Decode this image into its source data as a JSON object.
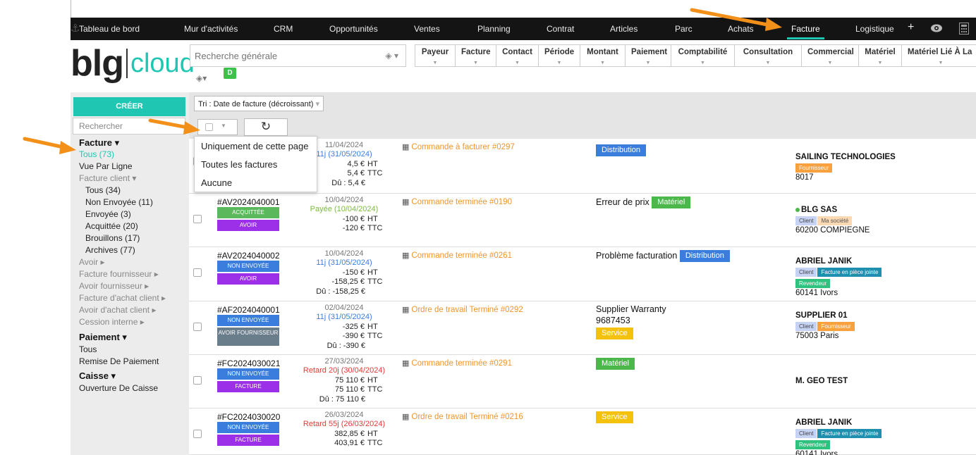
{
  "topnav": {
    "items": [
      "Tableau de bord",
      "Mur d'activités",
      "CRM",
      "Opportunités",
      "Ventes",
      "Planning",
      "Contrat",
      "Articles",
      "Parc",
      "Achats",
      "Facture",
      "Logistique",
      "+"
    ],
    "active": "Facture"
  },
  "logo": {
    "left": "blg",
    "right": "cloud"
  },
  "search": {
    "placeholder": "Recherche générale",
    "badge": "D"
  },
  "filters": [
    "Payeur",
    "Facture",
    "Contact",
    "Période",
    "Montant",
    "Paiement",
    "Comptabilité",
    "Consultation",
    "Commercial",
    "Matériel",
    "Matériel Lié À La"
  ],
  "sidebar": {
    "create": "CRÉER",
    "search_placeholder": "Rechercher",
    "facture_header": "Facture ▾",
    "items": [
      {
        "label": "Tous (73)",
        "style": "active"
      },
      {
        "label": "Vue Par Ligne",
        "style": ""
      },
      {
        "label": "Facture client ▾",
        "style": "grey"
      },
      {
        "label": "Tous (34)",
        "style": "ind"
      },
      {
        "label": "Non Envoyée (11)",
        "style": "ind"
      },
      {
        "label": "Envoyée (3)",
        "style": "ind"
      },
      {
        "label": "Acquittée (20)",
        "style": "ind"
      },
      {
        "label": "Brouillons (17)",
        "style": "ind"
      },
      {
        "label": "Archives (77)",
        "style": "ind"
      },
      {
        "label": "Avoir ▸",
        "style": "grey"
      },
      {
        "label": "Facture fournisseur ▸",
        "style": "grey"
      },
      {
        "label": "Avoir fournisseur ▸",
        "style": "grey"
      },
      {
        "label": "Facture d'achat client ▸",
        "style": "grey"
      },
      {
        "label": "Avoir d'achat client ▸",
        "style": "grey"
      },
      {
        "label": "Cession interne ▸",
        "style": "grey"
      }
    ],
    "paiement_header": "Paiement ▾",
    "paiement_items": [
      "Tous",
      "Remise De Paiement"
    ],
    "caisse_header": "Caisse ▾",
    "caisse_items": [
      "Ouverture De Caisse"
    ]
  },
  "sort": {
    "label": "Tri : Date de facture (décroissant)"
  },
  "dropdown": {
    "options": [
      "Uniquement de cette page",
      "Toutes les factures",
      "Aucune"
    ]
  },
  "rows": [
    {
      "number": "",
      "badges": [],
      "date": "11/04/2024",
      "due": "11j (31/05/2024)",
      "due_color": "blue",
      "ht": "4,5 €",
      "ttc": "5,4 €",
      "du": "Dû : 5,4 €",
      "cmd": "Commande à facturer #0297",
      "obj_text": "",
      "obj_tag": "Distribution",
      "obj_tag_color": "blue",
      "obj_sub": "",
      "client": "SAILING TECHNOLOGIES",
      "client_dot": false,
      "client_tags": [
        {
          "t": "Fournisseur",
          "c": "orange"
        }
      ],
      "client_tags2": [],
      "client_addr": "8017"
    },
    {
      "number": "#AV2024040001",
      "badges": [
        {
          "t": "ACQUITTÉE",
          "c": "green"
        },
        {
          "t": "AVOIR",
          "c": "purple"
        }
      ],
      "date": "10/04/2024",
      "due": "Payée (10/04/2024)",
      "due_color": "green",
      "ht": "-100 €",
      "ttc": "-120 €",
      "du": "",
      "cmd": "Commande terminée #0190",
      "obj_text": "Erreur de prix",
      "obj_tag": "Matériel",
      "obj_tag_color": "green",
      "obj_sub": "",
      "client": "BLG SAS",
      "client_dot": true,
      "client_tags": [
        {
          "t": "Client",
          "c": "client"
        },
        {
          "t": "Ma société",
          "c": "soc"
        }
      ],
      "client_tags2": [],
      "client_addr": "60200 COMPIEGNE"
    },
    {
      "number": "#AV2024040002",
      "badges": [
        {
          "t": "NON ENVOYÉE",
          "c": "blue"
        },
        {
          "t": "AVOIR",
          "c": "purple"
        }
      ],
      "date": "10/04/2024",
      "due": "11j (31/05/2024)",
      "due_color": "blue",
      "ht": "-150 €",
      "ttc": "-158,25 €",
      "du": "Dû : -158,25 €",
      "cmd": "Commande terminée #0261",
      "obj_text": "Problème facturation",
      "obj_tag": "Distribution",
      "obj_tag_color": "blue",
      "obj_sub": "",
      "client": "ABRIEL JANIK",
      "client_dot": false,
      "client_tags": [
        {
          "t": "Client",
          "c": "client"
        },
        {
          "t": "Facture en pièce jointe",
          "c": "teal"
        }
      ],
      "client_tags2": [
        {
          "t": "Revendeur",
          "c": "green"
        }
      ],
      "client_addr": "60141 Ivors"
    },
    {
      "number": "#AF2024040001",
      "badges": [
        {
          "t": "NON ENVOYÉE",
          "c": "blue"
        },
        {
          "t": "AVOIR FOURNISSEUR",
          "c": "grey"
        }
      ],
      "date": "02/04/2024",
      "due": "11j (31/05/2024)",
      "due_color": "blue",
      "ht": "-325 €",
      "ttc": "-390 €",
      "du": "Dû : -390 €",
      "cmd": "Ordre de travail Terminé #0292",
      "obj_text": "Supplier Warranty",
      "obj_tag": "Service",
      "obj_tag_color": "yellow",
      "obj_sub": "9687453",
      "client": "SUPPLIER 01",
      "client_dot": false,
      "client_tags": [
        {
          "t": "Client",
          "c": "client"
        },
        {
          "t": "Fournisseur",
          "c": "orange"
        }
      ],
      "client_tags2": [],
      "client_addr": "75003 Paris"
    },
    {
      "number": "#FC2024030021",
      "badges": [
        {
          "t": "NON ENVOYÉE",
          "c": "blue"
        },
        {
          "t": "FACTURE",
          "c": "purple"
        }
      ],
      "date": "27/03/2024",
      "due": "Retard 20j (30/04/2024)",
      "due_color": "red",
      "ht": "75 110 €",
      "ttc": "75 110 €",
      "du": "Dû : 75 110 €",
      "cmd": "Commande terminée #0291",
      "obj_text": "",
      "obj_tag": "Matériel",
      "obj_tag_color": "green",
      "obj_sub": "",
      "client": "M. GEO TEST",
      "client_dot": false,
      "client_tags": [],
      "client_tags2": [],
      "client_addr": ""
    },
    {
      "number": "#FC2024030020",
      "badges": [
        {
          "t": "NON ENVOYÉE",
          "c": "blue"
        },
        {
          "t": "FACTURE",
          "c": "purple"
        }
      ],
      "date": "26/03/2024",
      "due": "Retard 55j (26/03/2024)",
      "due_color": "red",
      "ht": "382,85 €",
      "ttc": "403,91 €",
      "du": "",
      "cmd": "Ordre de travail Terminé #0216",
      "obj_text": "",
      "obj_tag": "Service",
      "obj_tag_color": "yellow",
      "obj_sub": "",
      "client": "ABRIEL JANIK",
      "client_dot": false,
      "client_tags": [
        {
          "t": "Client",
          "c": "client"
        },
        {
          "t": "Facture en pièce jointe",
          "c": "teal"
        }
      ],
      "client_tags2": [
        {
          "t": "Revendeur",
          "c": "green"
        }
      ],
      "client_addr": "60141 Ivors"
    }
  ],
  "units": {
    "ht": "HT",
    "ttc": "TTC"
  },
  "colors": {
    "accent": "#1fc6b2",
    "arrow": "#f39019",
    "nav_bg": "#141414"
  }
}
